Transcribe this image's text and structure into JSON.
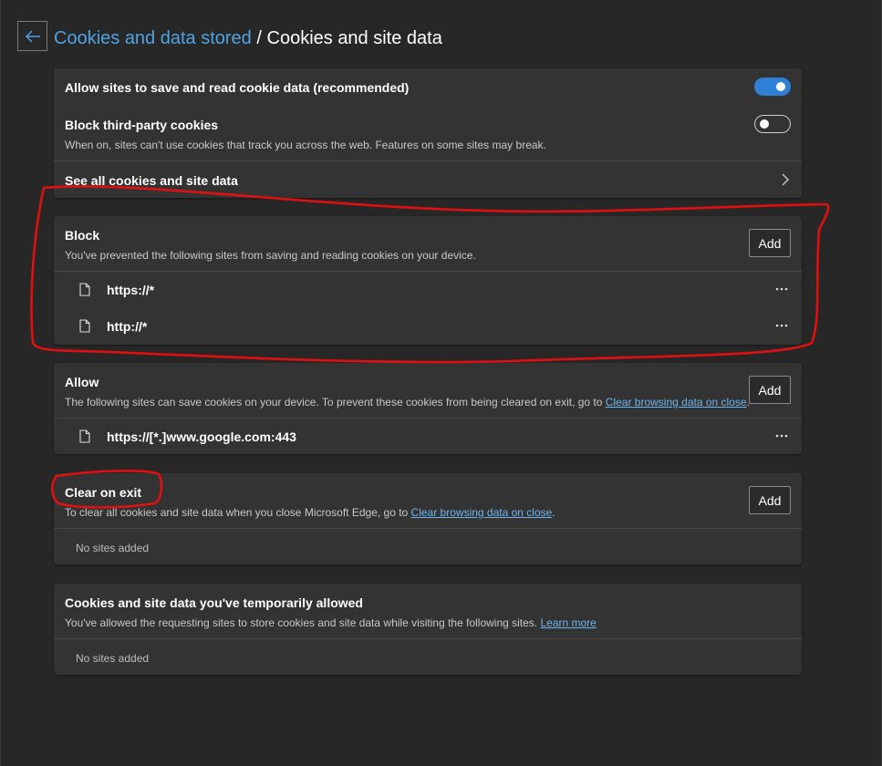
{
  "header": {
    "breadcrumb_parent": "Cookies and data stored",
    "separator": "/",
    "current": "Cookies and site data",
    "back_icon": "arrow-left-icon"
  },
  "general": {
    "allow_save_read": {
      "label": "Allow sites to save and read cookie data (recommended)",
      "enabled": true
    },
    "block_third_party": {
      "label": "Block third-party cookies",
      "description": "When on, sites can't use cookies that track you across the web. Features on some sites may break.",
      "enabled": false
    },
    "see_all": {
      "label": "See all cookies and site data",
      "icon": "chevron-right-icon"
    }
  },
  "block": {
    "title": "Block",
    "description": "You've prevented the following sites from saving and reading cookies on your device.",
    "add_label": "Add",
    "sites": [
      "https://*",
      "http://*"
    ]
  },
  "allow": {
    "title": "Allow",
    "description_prefix": "The following sites can save cookies on your device. To prevent these cookies from being cleared on exit, go to ",
    "link": "Clear browsing data on close",
    "description_suffix": ".",
    "add_label": "Add",
    "sites": [
      "https://[*.]www.google.com:443"
    ]
  },
  "clear_on_exit": {
    "title": "Clear on exit",
    "description_prefix": "To clear all cookies and site data when you close Microsoft Edge, go to ",
    "link": "Clear browsing data on close",
    "description_suffix": ".",
    "add_label": "Add",
    "empty": "No sites added"
  },
  "temporarily_allowed": {
    "title": "Cookies and site data you've temporarily allowed",
    "description_prefix": "You've allowed the requesting sites to store cookies and site data while visiting the following sites. ",
    "link": "Learn more",
    "empty": "No sites added"
  },
  "colors": {
    "background": "#272727",
    "card": "#333333",
    "accent": "#2f7fd5",
    "link": "#6db4ef",
    "annotation": "#e01010"
  }
}
